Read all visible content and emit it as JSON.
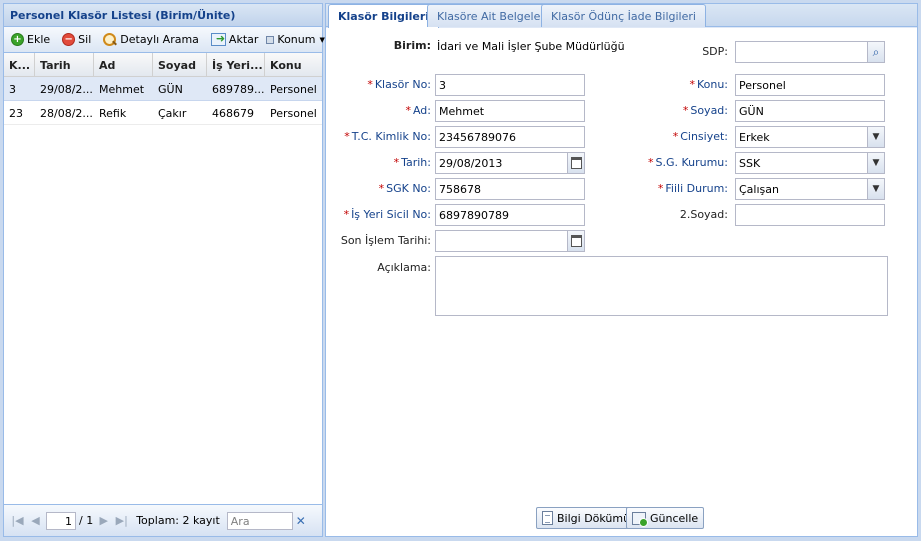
{
  "left_panel": {
    "title": "Personel Klasör Listesi (Birim/Ünite)",
    "toolbar": {
      "add_label": "Ekle",
      "delete_label": "Sil",
      "detailed_search_label": "Detaylı Arama",
      "export_label": "Aktar",
      "position_label": "Konum"
    },
    "columns": [
      "K...",
      "Tarih",
      "Ad",
      "Soyad",
      "İş Yeri...",
      "Konu"
    ],
    "rows": [
      [
        "3",
        "29/08/2...",
        "Mehmet",
        "GÜN",
        "689789...",
        "Personel"
      ],
      [
        "23",
        "28/08/2...",
        "Refik",
        "Çakır",
        "468679",
        "Personel"
      ]
    ],
    "pager": {
      "page": "1",
      "page_total": "/ 1",
      "total_text": "Toplam: 2 kayıt",
      "search_placeholder": "Ara"
    }
  },
  "right_panel": {
    "tabs": [
      "Klasör Bilgileri",
      "Klasöre Ait Belgeler",
      "Klasör Ödünç İade Bilgileri"
    ],
    "form": {
      "birim_label": "Birim:",
      "birim_value": "İdari ve Mali İşler Şube Müdürlüğü",
      "sdp_label": "SDP:",
      "sdp_value": "",
      "klasor_no_label": "Klasör No:",
      "klasor_no_value": "3",
      "konu_label": "Konu:",
      "konu_value": "Personel",
      "ad_label": "Ad:",
      "ad_value": "Mehmet",
      "soyad_label": "Soyad:",
      "soyad_value": "GÜN",
      "tc_label": "T.C. Kimlik No:",
      "tc_value": "23456789076",
      "cinsiyet_label": "Cinsiyet:",
      "cinsiyet_value": "Erkek",
      "tarih_label": "Tarih:",
      "tarih_value": "29/08/2013",
      "sg_label": "S.G. Kurumu:",
      "sg_value": "SSK",
      "sgk_label": "SGK No:",
      "sgk_value": "758678",
      "fiili_label": "Fiili Durum:",
      "fiili_value": "Çalışan",
      "isyeri_label": "İş Yeri Sicil No:",
      "isyeri_value": "6897890789",
      "soyad2_label": "2.Soyad:",
      "soyad2_value": "",
      "son_islem_label": "Son İşlem Tarihi:",
      "son_islem_value": "",
      "aciklama_label": "Açıklama:",
      "aciklama_value": ""
    },
    "buttons": {
      "print_label": "Bilgi Dökümü",
      "update_label": "Güncelle"
    }
  }
}
